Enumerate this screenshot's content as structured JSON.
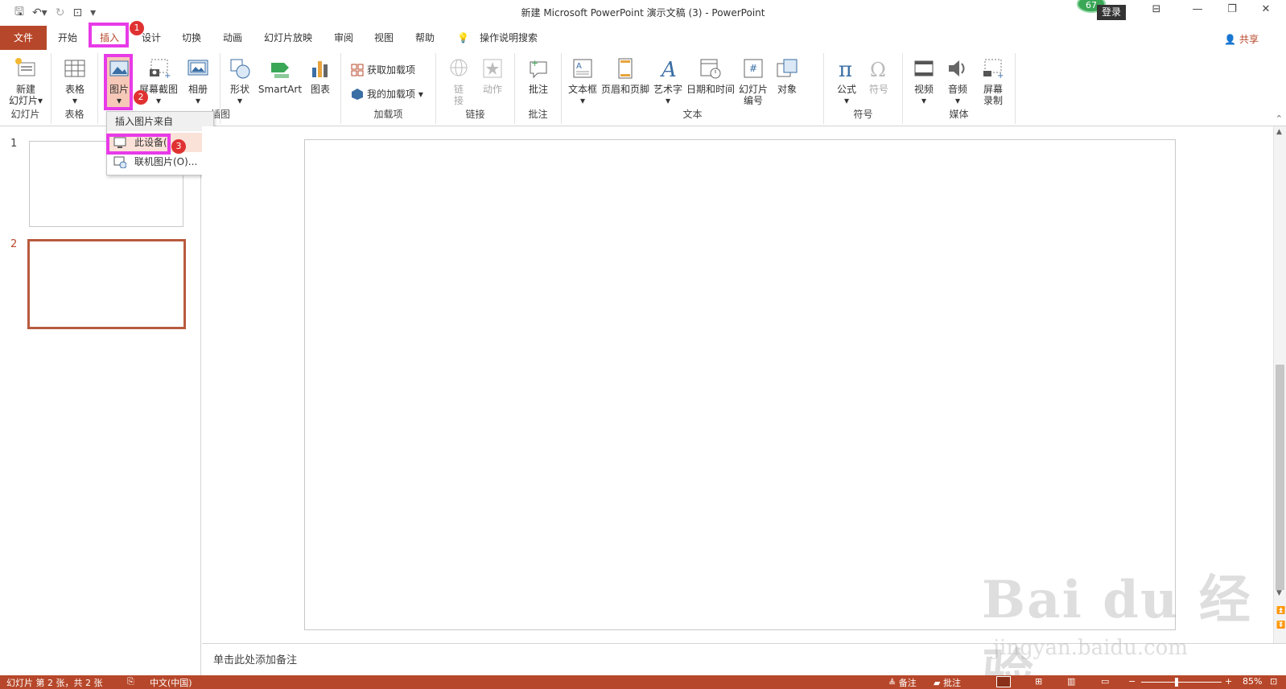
{
  "titlebar": {
    "title": "新建 Microsoft PowerPoint 演示文稿 (3)  -  PowerPoint",
    "login": "登录",
    "badge": "67"
  },
  "tabs": [
    "文件",
    "开始",
    "插入",
    "设计",
    "切换",
    "动画",
    "幻灯片放映",
    "审阅",
    "视图",
    "帮助",
    "操作说明搜索"
  ],
  "share": "共享",
  "markers": [
    "1",
    "2",
    "3"
  ],
  "ribbon": {
    "slides": {
      "new_slide": "新建",
      "new_slide2": "幻灯片",
      "label": "幻灯片"
    },
    "tables": {
      "table": "表格",
      "label": "表格"
    },
    "images": {
      "picture": "图片",
      "screenshot": "屏幕截图",
      "album": "相册",
      "label": "插图"
    },
    "illustrations": {
      "shapes": "形状",
      "smartart": "SmartArt",
      "chart": "图表"
    },
    "addins": {
      "get": "获取加载项",
      "mine": "我的加载项",
      "label": "加载项"
    },
    "links": {
      "link": "链",
      "link2": "接",
      "action": "动作",
      "label": "链接"
    },
    "comments": {
      "comment": "批注",
      "label": "批注"
    },
    "text": {
      "textbox": "文本框",
      "header": "页眉和页脚",
      "wordart": "艺术字",
      "datetime": "日期和时间",
      "slidenum": "幻灯片",
      "slidenum2": "编号",
      "object": "对象",
      "label": "文本"
    },
    "symbols": {
      "equation": "公式",
      "symbol": "符号",
      "label": "符号"
    },
    "media": {
      "video": "视频",
      "audio": "音频",
      "screenrec": "屏幕",
      "screenrec2": "录制",
      "label": "媒体"
    }
  },
  "dropdown": {
    "header": "插入图片来自",
    "this_device": "此设备(",
    "online": "联机图片(O)..."
  },
  "thumbnails": {
    "n1": "1",
    "n2": "2"
  },
  "notes": "单击此处添加备注",
  "watermark": {
    "logo": "Bai du 经验",
    "url": "jingyan.baidu.com"
  },
  "status": {
    "slide_info": "幻灯片 第 2 张，共 2 张",
    "language": "中文(中国)",
    "notes": "备注",
    "comments": "批注",
    "zoom": "85%"
  }
}
